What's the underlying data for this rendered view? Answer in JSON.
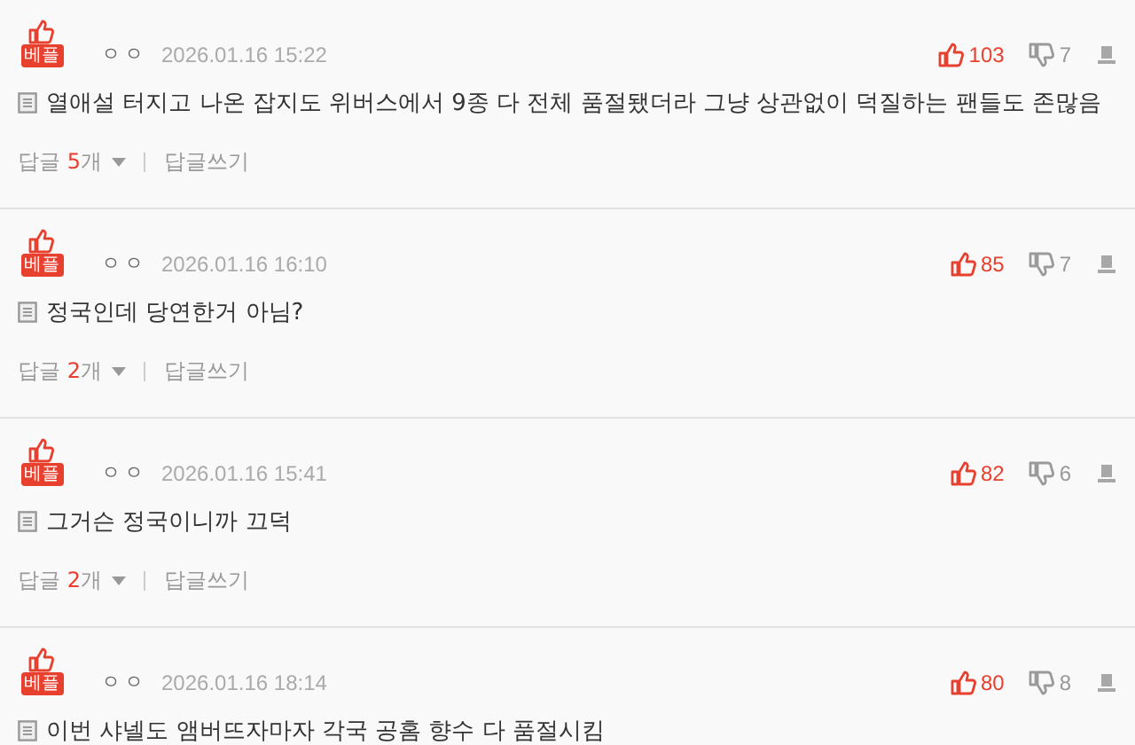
{
  "comments": [
    {
      "badge": "베플",
      "author": "ㅇㅇ",
      "date": "2026.01.16 15:22",
      "likes": "103",
      "dislikes": "7",
      "text": "열애설 터지고 나온 잡지도 위버스에서 9종 다 전체 품절됐더라 그냥 상관없이 덕질하는 팬들도 존많음",
      "replies": {
        "label": "답글",
        "count": "5",
        "unit": "개"
      },
      "write_reply": "답글쓰기"
    },
    {
      "badge": "베플",
      "author": "ㅇㅇ",
      "date": "2026.01.16 16:10",
      "likes": "85",
      "dislikes": "7",
      "text": "정국인데 당연한거 아님?",
      "replies": {
        "label": "답글",
        "count": "2",
        "unit": "개"
      },
      "write_reply": "답글쓰기"
    },
    {
      "badge": "베플",
      "author": "ㅇㅇ",
      "date": "2026.01.16 15:41",
      "likes": "82",
      "dislikes": "6",
      "text": "그거슨 정국이니까 끄덕",
      "replies": {
        "label": "답글",
        "count": "2",
        "unit": "개"
      },
      "write_reply": "답글쓰기"
    },
    {
      "badge": "베플",
      "author": "ㅇㅇ",
      "date": "2026.01.16 18:14",
      "likes": "80",
      "dislikes": "8",
      "text": "이번 샤넬도 앰버뜨자마자 각국 공홈 향수 다 품절시킴"
    }
  ]
}
